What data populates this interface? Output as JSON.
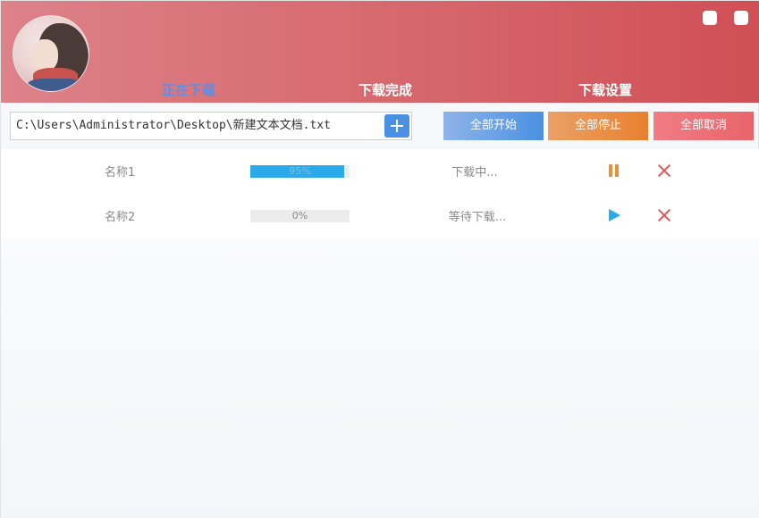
{
  "window": {
    "title": "",
    "controls": {
      "minimize_icon": "square-icon",
      "close_icon": "square-icon"
    },
    "header_gradient": [
      "#dc8289",
      "#d04f55"
    ]
  },
  "tabs": [
    {
      "label": "正在下载",
      "active": true
    },
    {
      "label": "下载完成",
      "active": false
    },
    {
      "label": "下载设置",
      "active": false
    }
  ],
  "toolbar": {
    "path_value": "C:\\Users\\Administrator\\Desktop\\新建文本文档.txt",
    "add_icon": "plus-icon",
    "start_all_label": "全部开始",
    "stop_all_label": "全部停止",
    "cancel_all_label": "全部取消"
  },
  "downloads": [
    {
      "name": "名称1",
      "progress": 0.95,
      "progress_label": "95%",
      "status": "下载中...",
      "action_icon": "pause-icon",
      "remove_icon": "close-icon"
    },
    {
      "name": "名称2",
      "progress": 0.0,
      "progress_label": "0%",
      "status": "等待下载...",
      "action_icon": "play-icon",
      "remove_icon": "close-icon"
    }
  ],
  "colors": {
    "accent_blue": "#4a90e2",
    "progress_fill": "#2aaae8",
    "pause_orange": "#e8913a",
    "remove_red": "#e55a5f"
  }
}
